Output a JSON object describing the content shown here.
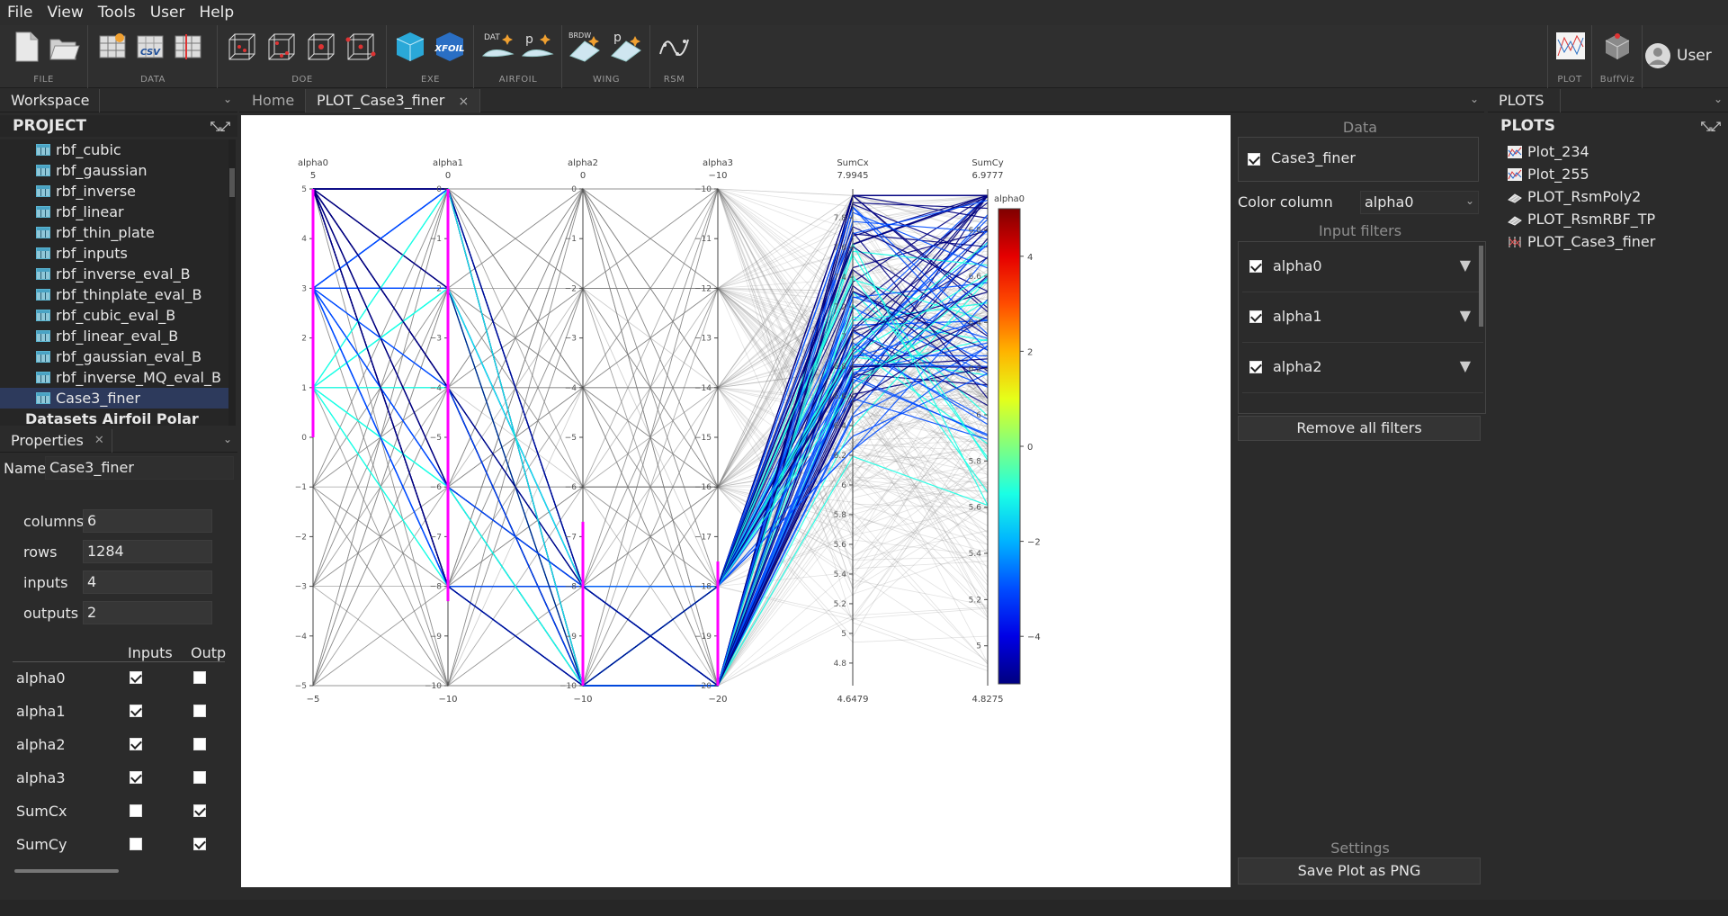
{
  "menu": [
    "File",
    "View",
    "Tools",
    "User",
    "Help"
  ],
  "toolbar": {
    "groups": [
      "FILE",
      "DATA",
      "DOE",
      "EXE",
      "AIRFOIL",
      "WING",
      "RSM",
      "PLOT",
      "BuffViz"
    ],
    "icon_texts": {
      "csv": "CSV",
      "xfoil": "XFOIL",
      "dat": "DAT",
      "p1": "p",
      "brdw": "BRDW",
      "p2": "p"
    },
    "user_label": "User"
  },
  "workspace": {
    "title": "Workspace",
    "project_label": "PROJECT",
    "items": [
      "rbf_cubic",
      "rbf_gaussian",
      "rbf_inverse",
      "rbf_linear",
      "rbf_thin_plate",
      "rbf_inputs",
      "rbf_inverse_eval_B",
      "rbf_thinplate_eval_B",
      "rbf_cubic_eval_B",
      "rbf_linear_eval_B",
      "rbf_gaussian_eval_B",
      "rbf_inverse_MQ_eval_B",
      "Case3_finer"
    ],
    "selected": "Case3_finer",
    "next_group": "Datasets Airfoil Polar"
  },
  "properties": {
    "title": "Properties",
    "name_label": "Name",
    "name_value": "Case3_finer",
    "stats": [
      {
        "label": "columns",
        "value": "6"
      },
      {
        "label": "rows",
        "value": "1284"
      },
      {
        "label": "inputs",
        "value": "4"
      },
      {
        "label": "outputs",
        "value": "2"
      }
    ],
    "col_inputs": "Inputs",
    "col_outputs": "Outp",
    "vars": [
      {
        "name": "alpha0",
        "input": true,
        "output": false
      },
      {
        "name": "alpha1",
        "input": true,
        "output": false
      },
      {
        "name": "alpha2",
        "input": true,
        "output": false
      },
      {
        "name": "alpha3",
        "input": true,
        "output": false
      },
      {
        "name": "SumCx",
        "input": false,
        "output": true
      },
      {
        "name": "SumCy",
        "input": false,
        "output": true
      }
    ]
  },
  "tabs": [
    "Home",
    "PLOT_Case3_finer"
  ],
  "tab_close": "×",
  "settings": {
    "data_title": "Data",
    "dataset": "Case3_finer",
    "color_column_label": "Color column",
    "color_column_value": "alpha0",
    "input_filters_title": "Input filters",
    "filters": [
      "alpha0",
      "alpha1",
      "alpha2"
    ],
    "remove_filters": "Remove all filters",
    "settings_title": "Settings",
    "save_png": "Save Plot as PNG"
  },
  "plots_panel": {
    "head": "PLOTS",
    "title": "PLOTS",
    "items": [
      "Plot_234",
      "Plot_255",
      "PLOT_RsmPoly2",
      "PLOT_RsmRBF_TP",
      "PLOT_Case3_finer"
    ]
  },
  "chart_data": {
    "type": "parallel_coordinates",
    "dimensions": [
      {
        "name": "alpha0",
        "top": "5",
        "bottom": "−5",
        "range": [
          -5,
          5
        ],
        "ticks": [
          "5",
          "4",
          "3",
          "2",
          "1",
          "0",
          "−1",
          "−2",
          "−3",
          "−4",
          "−5"
        ],
        "tick_values": [
          5,
          4,
          3,
          2,
          1,
          0,
          -1,
          -2,
          -3,
          -4,
          -5
        ],
        "filter": [
          0,
          5
        ]
      },
      {
        "name": "alpha1",
        "top": "0",
        "bottom": "−10",
        "range": [
          -10,
          0
        ],
        "ticks": [
          "0",
          "−1",
          "−2",
          "−3",
          "−4",
          "−5",
          "−6",
          "−7",
          "−8",
          "−9",
          "−10"
        ],
        "tick_values": [
          0,
          -1,
          -2,
          -3,
          -4,
          -5,
          -6,
          -7,
          -8,
          -9,
          -10
        ],
        "filter": [
          -8.3,
          0
        ]
      },
      {
        "name": "alpha2",
        "top": "0",
        "bottom": "−10",
        "range": [
          -10,
          0
        ],
        "ticks": [
          "0",
          "−1",
          "−2",
          "−3",
          "−4",
          "−5",
          "−6",
          "−7",
          "−8",
          "−9",
          "−10"
        ],
        "tick_values": [
          0,
          -1,
          -2,
          -3,
          -4,
          -5,
          -6,
          -7,
          -8,
          -9,
          -10
        ],
        "filter": [
          -10,
          -6.7
        ]
      },
      {
        "name": "alpha3",
        "top": "−10",
        "bottom": "−20",
        "range": [
          -20,
          -10
        ],
        "ticks": [
          "−10",
          "−11",
          "−12",
          "−13",
          "−14",
          "−15",
          "−16",
          "−17",
          "−18",
          "−19",
          "−20"
        ],
        "tick_values": [
          -10,
          -11,
          -12,
          -13,
          -14,
          -15,
          -16,
          -17,
          -18,
          -19,
          -20
        ],
        "filter": [
          -20,
          -17.5
        ]
      },
      {
        "name": "SumCx",
        "top": "7.9945",
        "bottom": "4.6479",
        "range": [
          4.6479,
          7.9945
        ],
        "ticks": [
          "7.8",
          "7.6",
          "7.4",
          "7.2",
          "7",
          "6.8",
          "6.6",
          "6.4",
          "6.2",
          "6",
          "5.8",
          "5.6",
          "5.4",
          "5.2",
          "5",
          "4.8"
        ],
        "tick_values": [
          7.8,
          7.6,
          7.4,
          7.2,
          7,
          6.8,
          6.6,
          6.4,
          6.2,
          6,
          5.8,
          5.6,
          5.4,
          5.2,
          5,
          4.8
        ]
      },
      {
        "name": "SumCy",
        "top": "6.9777",
        "bottom": "4.8275",
        "range": [
          4.8275,
          6.9777
        ],
        "ticks": [
          "6.8",
          "6.6",
          "6.4",
          "6.2",
          "6",
          "5.8",
          "5.6",
          "5.4",
          "5.2",
          "5"
        ],
        "tick_values": [
          6.8,
          6.6,
          6.4,
          6.2,
          6,
          5.8,
          5.6,
          5.4,
          5.2,
          5
        ]
      }
    ],
    "colorbar": {
      "title": "alpha0",
      "ticks": [
        "4",
        "2",
        "0",
        "−2",
        "−4"
      ],
      "tick_values": [
        4,
        2,
        0,
        -2,
        -4
      ],
      "range": [
        -5,
        5
      ],
      "colorscale": "jet_reversed"
    },
    "selected_color": "#ff00ff",
    "unselected_color": "#7a7a7a"
  }
}
